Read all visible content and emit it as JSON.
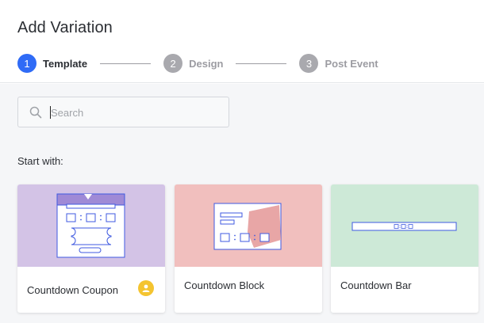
{
  "title": "Add Variation",
  "steps": [
    {
      "number": "1",
      "label": "Template",
      "state": "active"
    },
    {
      "number": "2",
      "label": "Design",
      "state": "inactive"
    },
    {
      "number": "3",
      "label": "Post Event",
      "state": "inactive"
    }
  ],
  "search": {
    "placeholder": "Search",
    "value": ""
  },
  "start_label": "Start with:",
  "templates": [
    {
      "label": "Countdown Coupon",
      "thumb_color": "#d3c3e6",
      "badge": "user-icon"
    },
    {
      "label": "Countdown Block",
      "thumb_color": "#f1bfbe"
    },
    {
      "label": "Countdown Bar",
      "thumb_color": "#cde9d7"
    }
  ],
  "colors": {
    "accent": "#2f6bf6",
    "outline": "#3f5ae0",
    "badge": "#f4c430"
  }
}
